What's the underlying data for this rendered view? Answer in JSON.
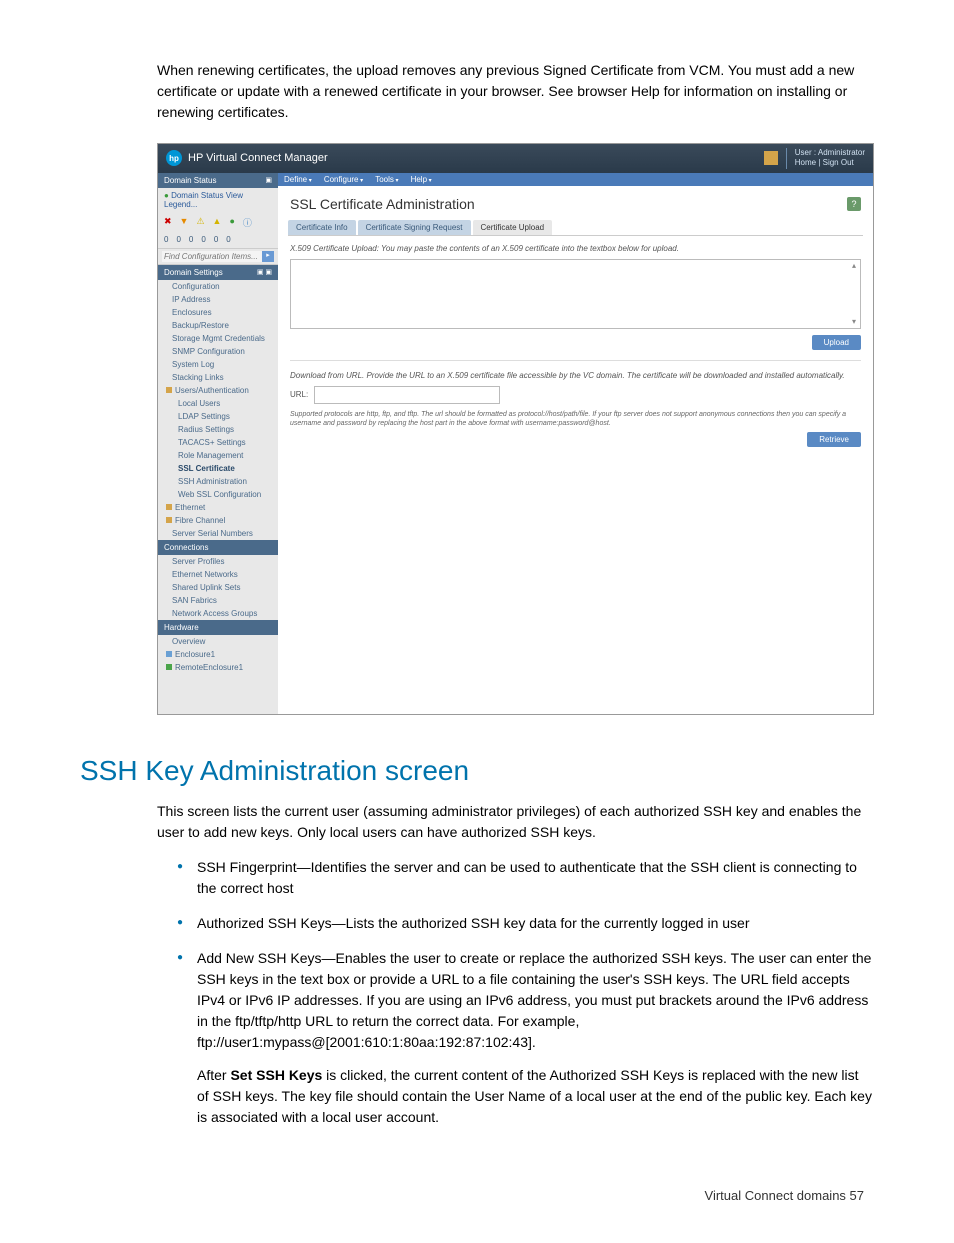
{
  "intro": "When renewing certificates, the upload removes any previous Signed Certificate from VCM. You must add a new certificate or update with a renewed certificate in your browser. See browser Help for information on installing or renewing certificates.",
  "screenshot": {
    "header": {
      "logo_text": "hp",
      "title": "HP Virtual Connect Manager",
      "user_label": "User : Administrator",
      "links": "Home  |  Sign Out"
    },
    "menubar": [
      "Define",
      "Configure",
      "Tools",
      "Help"
    ],
    "sidebar": {
      "status_header": "Domain Status",
      "status_links": "Domain Status   View Legend...",
      "status_counts": [
        "0",
        "0",
        "0",
        "0",
        "0",
        "0"
      ],
      "search_placeholder": "Find Configuration Items...",
      "settings_header": "Domain Settings",
      "settings_items": [
        "Configuration",
        "IP Address",
        "Enclosures",
        "Backup/Restore",
        "Storage Mgmt Credentials",
        "SNMP Configuration",
        "System Log",
        "Stacking Links"
      ],
      "users_group": "Users/Authentication",
      "users_items": [
        "Local Users",
        "LDAP Settings",
        "Radius Settings",
        "TACACS+ Settings",
        "Role Management",
        "SSL Certificate",
        "SSH Administration",
        "Web SSL Configuration"
      ],
      "ethernet": "Ethernet",
      "fibre": "Fibre Channel",
      "serial": "Server Serial Numbers",
      "connections_header": "Connections",
      "connections_items": [
        "Server Profiles",
        "Ethernet Networks",
        "Shared Uplink Sets",
        "SAN Fabrics",
        "Network Access Groups"
      ],
      "hardware_header": "Hardware",
      "hardware_items": [
        "Overview"
      ],
      "enclosure1": "Enclosure1",
      "remote_enclosure": "RemoteEnclosure1"
    },
    "main": {
      "page_title": "SSL Certificate Administration",
      "help_icon": "?",
      "tabs": [
        "Certificate Info",
        "Certificate Signing Request",
        "Certificate Upload"
      ],
      "upload_desc": "X.509 Certificate Upload: You may paste the contents of an X.509 certificate into the textbox below for upload.",
      "upload_btn": "Upload",
      "download_desc": "Download from URL. Provide the URL to an X.509 certificate file accessible by the VC domain. The certificate will be downloaded and installed automatically.",
      "url_label": "URL:",
      "protocols_note": "Supported protocols are http, ftp, and tftp. The url should be formatted as protocol://host/path/file. If your ftp server does not support anonymous connections then you can specify a username and password by replacing the host part in the above format with username:password@host.",
      "retrieve_btn": "Retrieve"
    }
  },
  "heading": "SSH Key Administration screen",
  "para1": "This screen lists the current user (assuming administrator privileges) of each authorized SSH key and enables the user to add new keys. Only local users can have authorized SSH keys.",
  "bullets": {
    "b1": "SSH Fingerprint—Identifies the server and can be used to authenticate that the SSH client is connecting to the correct host",
    "b2": "Authorized SSH Keys—Lists the authorized SSH key data for the currently logged in user",
    "b3": "Add New SSH Keys—Enables the user to create or replace the authorized SSH keys. The user can enter the SSH keys in the text box or provide a URL to a file containing the user's SSH keys. The URL field accepts IPv4 or IPv6 IP addresses. If you are using an IPv6 address, you must put brackets around the IPv6 address in the ftp/tftp/http URL to return the correct data. For example, ftp://user1:mypass@[2001:610:1:80aa:192:87:102:43].",
    "b3_after_pre": "After ",
    "b3_after_bold": "Set SSH Keys",
    "b3_after_post": " is clicked, the current content of the Authorized SSH Keys is replaced with the new list of SSH keys. The key file should contain the User Name of a local user at the end of the public key. Each key is associated with a local user account."
  },
  "footer": "Virtual Connect domains   57"
}
